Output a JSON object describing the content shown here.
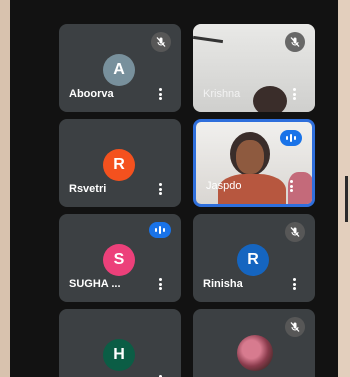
{
  "participants": [
    {
      "name": "Aboorva",
      "initial": "A",
      "avatar_color": "#78909c",
      "muted": true
    },
    {
      "name": "Krishna",
      "initial": "",
      "muted": true,
      "video": true
    },
    {
      "name": "Rsvetri",
      "initial": "R",
      "avatar_color": "#f4511e",
      "muted": false
    },
    {
      "name": "Jaspdo",
      "initial": "",
      "muted": false,
      "speaking": true,
      "video": true,
      "active": true
    },
    {
      "name": "SUGHA ...",
      "initial": "S",
      "avatar_color": "#ec407a",
      "speaking": true
    },
    {
      "name": "Rinisha",
      "initial": "R",
      "avatar_color": "#1565c0",
      "muted": true
    },
    {
      "name": "",
      "initial": "H",
      "avatar_color": "#0b5d45",
      "muted": false
    },
    {
      "name": "",
      "initial": "",
      "muted": true,
      "avatar_image": true
    }
  ],
  "colors": {
    "tile_bg": "#3c4043",
    "active_border": "#2f6fdc",
    "speaking_indicator": "#1a73e8"
  },
  "icons": {
    "mute": "mic-off-icon",
    "speaking": "audio-level-icon",
    "more": "more-vert-icon"
  }
}
